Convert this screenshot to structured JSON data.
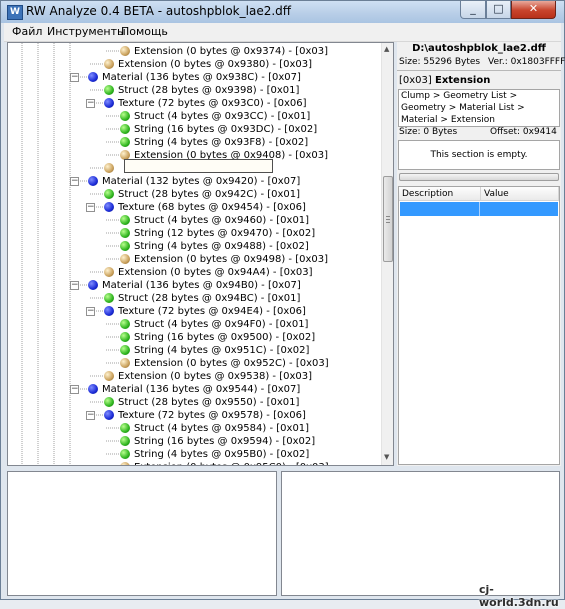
{
  "window": {
    "title": "RW Analyze 0.4 BETA - autoshpblok_lae2.dff",
    "app_icon": "rw-analyze-icon",
    "controls": [
      "minimize",
      "maximize",
      "close"
    ]
  },
  "menu": {
    "items": [
      "Файл",
      "Инструменты",
      "Помощь"
    ]
  },
  "tree": {
    "rows": [
      {
        "label": "Extension  (0 bytes @ 0x9374) - [0x03]",
        "type": "tan",
        "level": 5
      },
      {
        "label": "Extension  (0 bytes @ 0x9380) - [0x03]",
        "type": "tan",
        "level": 4
      },
      {
        "label": "Material  (136 bytes @ 0x938C) - [0x07]",
        "type": "blue",
        "level": 3,
        "expander": "−"
      },
      {
        "label": "Struct  (28 bytes @ 0x9398) - [0x01]",
        "type": "green",
        "level": 4
      },
      {
        "label": "Texture  (72 bytes @ 0x93C0) - [0x06]",
        "type": "blue",
        "level": 4,
        "expander": "−"
      },
      {
        "label": "Struct  (4 bytes @ 0x93CC) - [0x01]",
        "type": "green",
        "level": 5
      },
      {
        "label": "String  (16 bytes @ 0x93DC) - [0x02]",
        "type": "green",
        "level": 5
      },
      {
        "label": "String  (4 bytes @ 0x93F8) - [0x02]",
        "type": "green",
        "level": 5
      },
      {
        "label": "Extension  (0 bytes @ 0x9408) - [0x03]",
        "type": "tan",
        "level": 5
      },
      {
        "label": "",
        "type": "tan",
        "level": 4,
        "editing": true
      },
      {
        "label": "Material  (132 bytes @ 0x9420) - [0x07]",
        "type": "blue",
        "level": 3,
        "expander": "−"
      },
      {
        "label": "Struct  (28 bytes @ 0x942C) - [0x01]",
        "type": "green",
        "level": 4
      },
      {
        "label": "Texture  (68 bytes @ 0x9454) - [0x06]",
        "type": "blue",
        "level": 4,
        "expander": "−"
      },
      {
        "label": "Struct  (4 bytes @ 0x9460) - [0x01]",
        "type": "green",
        "level": 5
      },
      {
        "label": "String  (12 bytes @ 0x9470) - [0x02]",
        "type": "green",
        "level": 5
      },
      {
        "label": "String  (4 bytes @ 0x9488) - [0x02]",
        "type": "green",
        "level": 5
      },
      {
        "label": "Extension  (0 bytes @ 0x9498) - [0x03]",
        "type": "tan",
        "level": 5
      },
      {
        "label": "Extension  (0 bytes @ 0x94A4) - [0x03]",
        "type": "tan",
        "level": 4
      },
      {
        "label": "Material  (136 bytes @ 0x94B0) - [0x07]",
        "type": "blue",
        "level": 3,
        "expander": "−"
      },
      {
        "label": "Struct  (28 bytes @ 0x94BC) - [0x01]",
        "type": "green",
        "level": 4
      },
      {
        "label": "Texture  (72 bytes @ 0x94E4) - [0x06]",
        "type": "blue",
        "level": 4,
        "expander": "−"
      },
      {
        "label": "Struct  (4 bytes @ 0x94F0) - [0x01]",
        "type": "green",
        "level": 5
      },
      {
        "label": "String  (16 bytes @ 0x9500) - [0x02]",
        "type": "green",
        "level": 5
      },
      {
        "label": "String  (4 bytes @ 0x951C) - [0x02]",
        "type": "green",
        "level": 5
      },
      {
        "label": "Extension  (0 bytes @ 0x952C) - [0x03]",
        "type": "tan",
        "level": 5
      },
      {
        "label": "Extension  (0 bytes @ 0x9538) - [0x03]",
        "type": "tan",
        "level": 4
      },
      {
        "label": "Material  (136 bytes @ 0x9544) - [0x07]",
        "type": "blue",
        "level": 3,
        "expander": "−"
      },
      {
        "label": "Struct  (28 bytes @ 0x9550) - [0x01]",
        "type": "green",
        "level": 4
      },
      {
        "label": "Texture  (72 bytes @ 0x9578) - [0x06]",
        "type": "blue",
        "level": 4,
        "expander": "−"
      },
      {
        "label": "Struct  (4 bytes @ 0x9584) - [0x01]",
        "type": "green",
        "level": 5
      },
      {
        "label": "String  (16 bytes @ 0x9594) - [0x02]",
        "type": "green",
        "level": 5
      },
      {
        "label": "String  (4 bytes @ 0x95B0) - [0x02]",
        "type": "green",
        "level": 5
      },
      {
        "label": "Extension  (0 bytes @ 0x95C0) - [0x03]",
        "type": "tan",
        "level": 5
      }
    ],
    "scroll_position": 0.35
  },
  "info": {
    "filename": "D:\\autoshpblok_lae2.dff",
    "size_label": "Size: 55296 Bytes",
    "version_label": "Ver.: 0x1803FFFF",
    "section_id": "[0x03]",
    "section_name": "Extension",
    "path": "Clump > Geometry List > Geometry > Material List > Material > Extension",
    "section_size": "Size: 0 Bytes",
    "offset": "Offset: 0x9414",
    "empty_message": "This section is empty."
  },
  "grid": {
    "headers": [
      "Description",
      "Value"
    ]
  },
  "watermark": "cj-world.3dn.ru",
  "colors": {
    "selection": "#3399ff",
    "close_button": "#c8442c",
    "title_bar": "#b9cfe8"
  }
}
